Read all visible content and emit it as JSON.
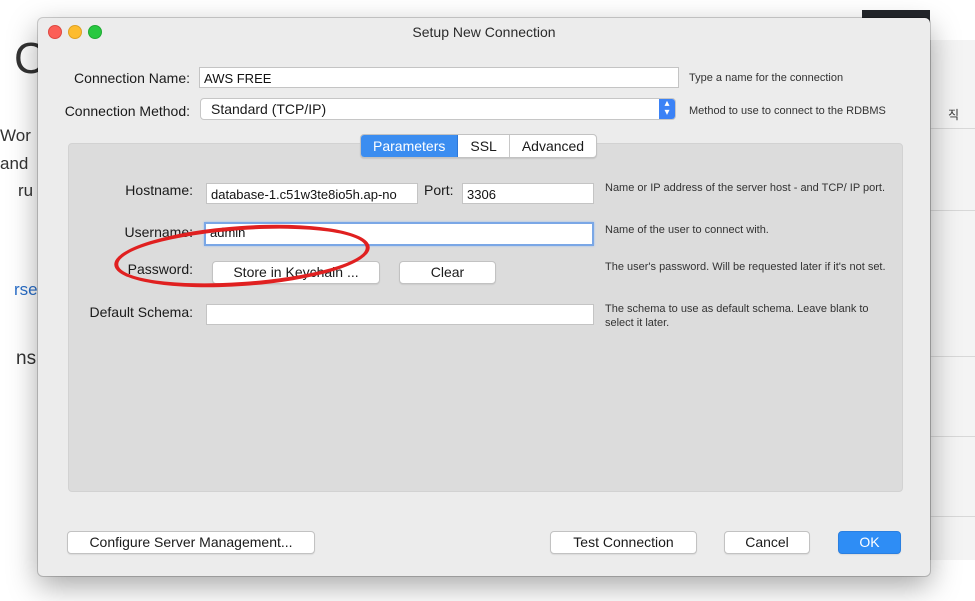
{
  "background": {
    "big_letter": "C",
    "fragments": [
      "Wor",
      "and",
      "ru",
      "rse",
      "ns"
    ],
    "right_char": "직"
  },
  "window": {
    "title": "Setup New Connection"
  },
  "connection_name": {
    "label": "Connection Name:",
    "value": "AWS FREE",
    "hint": "Type a name for the connection"
  },
  "connection_method": {
    "label": "Connection Method:",
    "value": "Standard (TCP/IP)",
    "hint": "Method to use to connect to the RDBMS"
  },
  "tabs": [
    {
      "label": "Parameters",
      "active": true
    },
    {
      "label": "SSL",
      "active": false
    },
    {
      "label": "Advanced",
      "active": false
    }
  ],
  "hostname": {
    "label": "Hostname:",
    "value": "database-1.c51w3te8io5h.ap-no",
    "hint": "Name or IP address of the server host - and TCP/ IP port."
  },
  "port": {
    "label": "Port:",
    "value": "3306"
  },
  "username": {
    "label": "Username:",
    "value": "admin",
    "hint": "Name of the user to connect with."
  },
  "password": {
    "label": "Password:",
    "store_button": "Store in Keychain ...",
    "clear_button": "Clear",
    "hint": "The user's password. Will be requested later if it's not set."
  },
  "default_schema": {
    "label": "Default Schema:",
    "value": "",
    "hint": "The schema to use as default schema. Leave blank to select it later."
  },
  "footer": {
    "configure_button": "Configure Server Management...",
    "test_button": "Test Connection",
    "cancel_button": "Cancel",
    "ok_button": "OK"
  },
  "colors": {
    "accent": "#2e8df5",
    "annotation_ring": "#e02020"
  }
}
